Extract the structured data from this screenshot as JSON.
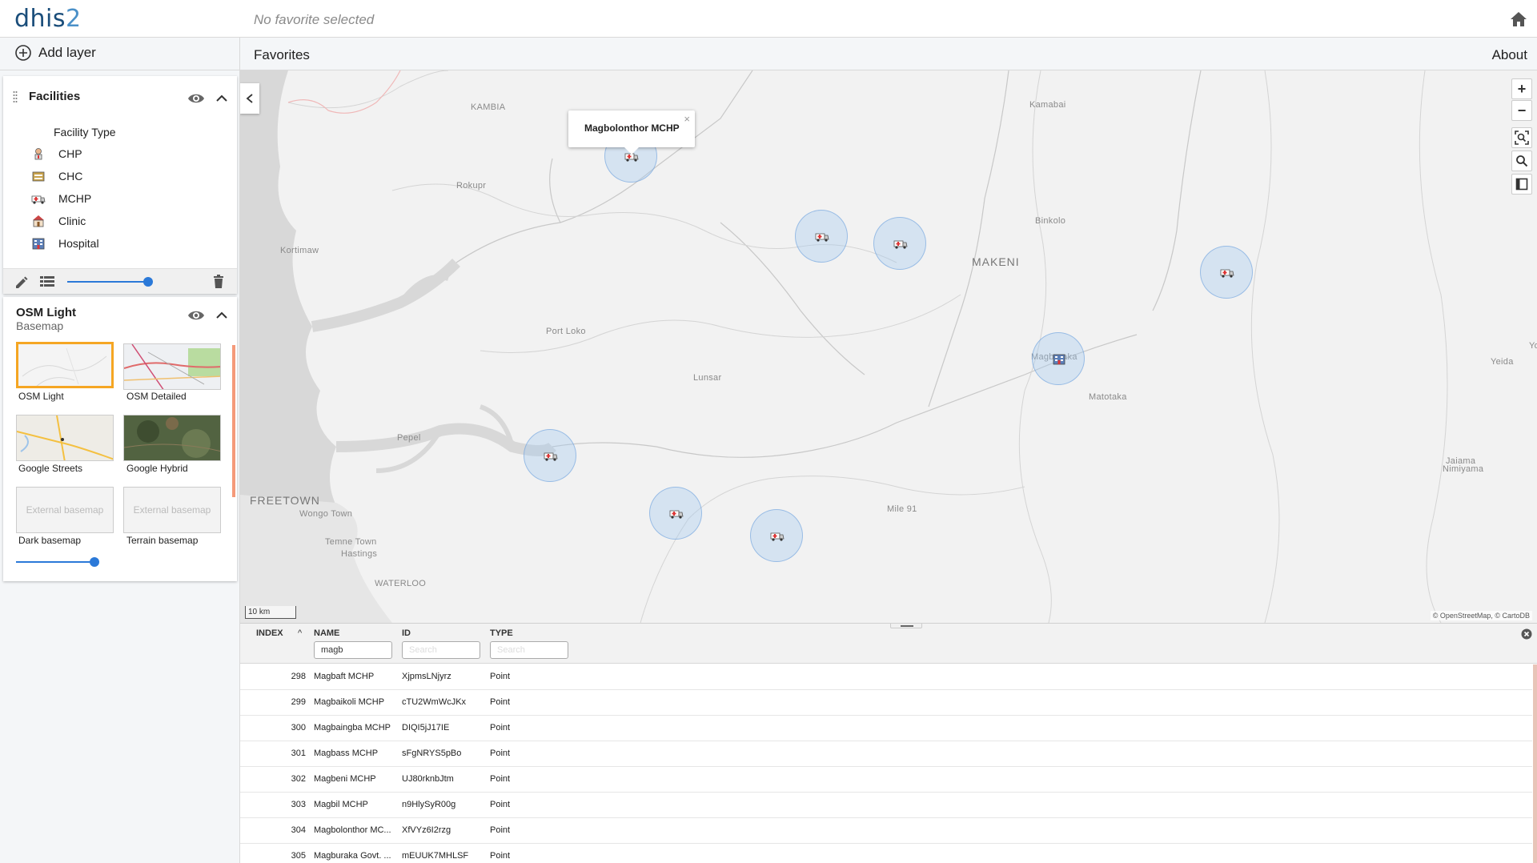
{
  "header": {
    "logo_main": "dhis",
    "logo_num": "2",
    "favorite_title": "No favorite selected"
  },
  "toolbar": {
    "add_layer_label": "Add layer",
    "favorites_label": "Favorites",
    "about_label": "About"
  },
  "facilities_layer": {
    "title": "Facilities",
    "legend_title": "Facility Type",
    "legend_items": [
      {
        "label": "CHP",
        "icon": "chp-icon"
      },
      {
        "label": "CHC",
        "icon": "chc-icon"
      },
      {
        "label": "MCHP",
        "icon": "mchp-icon"
      },
      {
        "label": "Clinic",
        "icon": "clinic-icon"
      },
      {
        "label": "Hospital",
        "icon": "hospital-icon"
      }
    ],
    "opacity": 1.0
  },
  "basemap_layer": {
    "title": "OSM Light",
    "subtitle": "Basemap",
    "options": [
      {
        "label": "OSM Light",
        "selected": true
      },
      {
        "label": "OSM Detailed",
        "selected": false
      },
      {
        "label": "Google Streets",
        "selected": false
      },
      {
        "label": "Google Hybrid",
        "selected": false
      },
      {
        "label": "Dark basemap",
        "selected": false,
        "placeholder": "External basemap"
      },
      {
        "label": "Terrain basemap",
        "selected": false,
        "placeholder": "External basemap"
      }
    ],
    "opacity": 1.0
  },
  "map": {
    "labels": {
      "kambia": "KAMBIA",
      "kamabai": "Kamabai",
      "rokupr": "Rokupr",
      "kortimaw": "Kortimaw",
      "binkolo": "Binkolo",
      "makeni": "MAKENI",
      "port_loko": "Port Loko",
      "lunsar": "Lunsar",
      "magburaka_partial": "Magburaka",
      "matotaka": "Matotaka",
      "yeida": "Yeida",
      "yo": "Yo",
      "pepel": "Pepel",
      "freetown": "FREETOWN",
      "wongo_town": "Wongo Town",
      "temne_town": "Temne Town",
      "hastings": "Hastings",
      "waterloo": "WATERLOO",
      "mile91": "Mile 91",
      "jaiama": "Jaiama",
      "nimiyama": "Nimiyama"
    },
    "popup_title": "Magbolonthor MCHP",
    "popup_close": "×",
    "scale_label": "10 km",
    "attribution": "© OpenStreetMap, © CartoDB",
    "zoom_in": "+",
    "zoom_out": "−",
    "accent": "#2b79d8",
    "selection_color": "#f5a623"
  },
  "data_table": {
    "columns": {
      "index": "INDEX",
      "name": "NAME",
      "id": "ID",
      "type": "TYPE"
    },
    "sort_indicator": "^",
    "filters": {
      "name_value": "magb",
      "id_placeholder": "Search",
      "type_placeholder": "Search"
    },
    "rows": [
      {
        "index": "298",
        "name": "Magbaft MCHP",
        "id": "XjpmsLNjyrz",
        "type": "Point"
      },
      {
        "index": "299",
        "name": "Magbaikoli MCHP",
        "id": "cTU2WmWcJKx",
        "type": "Point"
      },
      {
        "index": "300",
        "name": "Magbaingba MCHP",
        "id": "DIQI5jJ17IE",
        "type": "Point"
      },
      {
        "index": "301",
        "name": "Magbass MCHP",
        "id": "sFgNRYS5pBo",
        "type": "Point"
      },
      {
        "index": "302",
        "name": "Magbeni MCHP",
        "id": "UJ80rknbJtm",
        "type": "Point"
      },
      {
        "index": "303",
        "name": "Magbil MCHP",
        "id": "n9HlySyR00g",
        "type": "Point"
      },
      {
        "index": "304",
        "name": "Magbolonthor MC...",
        "id": "XfVYz6I2rzg",
        "type": "Point"
      },
      {
        "index": "305",
        "name": "Magburaka Govt. ...",
        "id": "mEUUK7MHLSF",
        "type": "Point"
      }
    ]
  }
}
